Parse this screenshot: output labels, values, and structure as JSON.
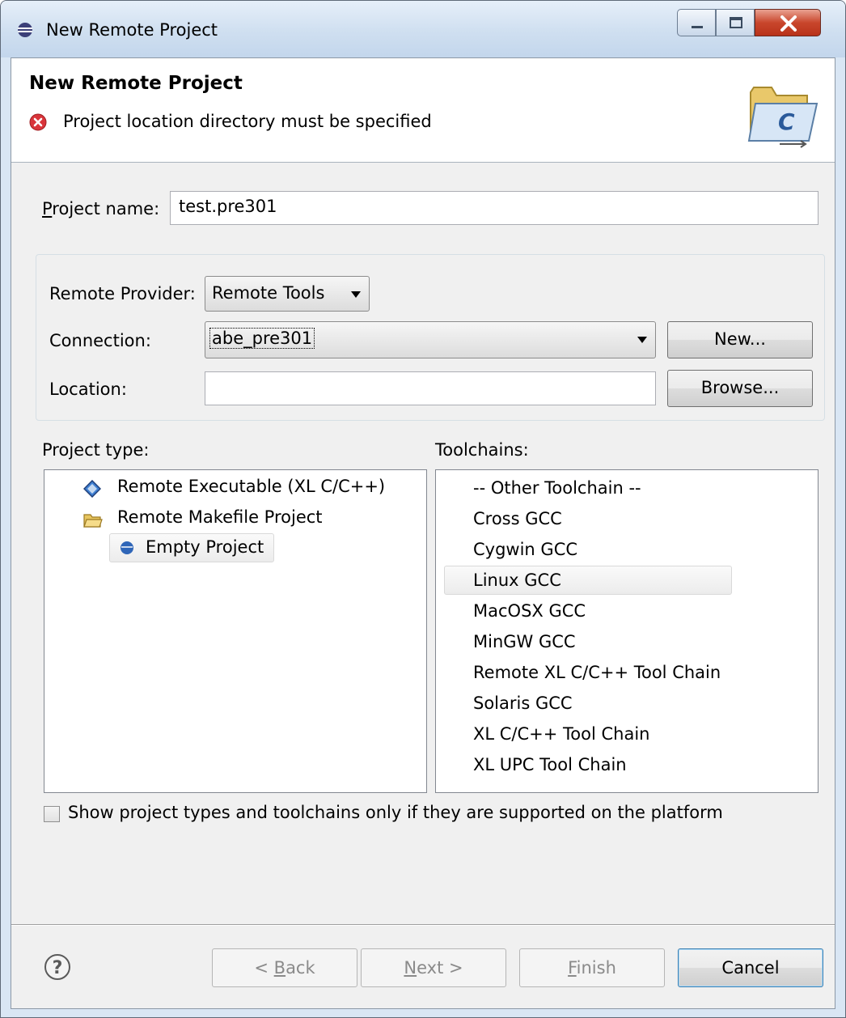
{
  "window": {
    "title": "New Remote Project"
  },
  "banner": {
    "title": "New Remote Project",
    "message": "Project location directory must be specified"
  },
  "project_name": {
    "label_mnemonic": "P",
    "label_rest": "roject name:",
    "value": "test.pre301"
  },
  "remote": {
    "provider_label": "Remote Provider:",
    "provider_value": "Remote Tools",
    "connection_label": "Connection:",
    "connection_value": "abe_pre301",
    "new_button": "New...",
    "location_label": "Location:",
    "location_value": "",
    "browse_button": "Browse..."
  },
  "project_types": {
    "label": "Project type:",
    "items": [
      {
        "label": "Remote Executable (XL C/C++)",
        "icon": "diamond-icon"
      },
      {
        "label": "Remote Makefile Project",
        "icon": "folder-icon"
      },
      {
        "label": "Empty Project",
        "icon": "bullet-icon",
        "selected": true
      }
    ]
  },
  "toolchains": {
    "label": "Toolchains:",
    "items": [
      "-- Other Toolchain --",
      "Cross GCC",
      "Cygwin GCC",
      "Linux GCC",
      "MacOSX GCC",
      "MinGW GCC",
      "Remote XL C/C++ Tool Chain",
      "Solaris GCC",
      "XL C/C++ Tool Chain",
      "XL UPC Tool Chain"
    ],
    "selected": "Linux GCC"
  },
  "filter_checkbox": {
    "label": "Show project types and toolchains only if they are supported on the platform",
    "checked": false
  },
  "buttons": {
    "back_prefix": "< ",
    "back_mnemonic": "B",
    "back_rest": "ack",
    "next_mnemonic": "N",
    "next_rest": "ext >",
    "finish_mnemonic": "F",
    "finish_rest": "inish",
    "cancel": "Cancel"
  },
  "colors": {
    "error": "#d9343a",
    "selection_border": "#d9d9d9",
    "title_bar": "#cfdff0"
  }
}
